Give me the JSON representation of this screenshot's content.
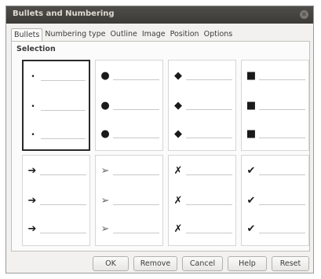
{
  "window": {
    "title": "Bullets and Numbering"
  },
  "tabs": [
    "Bullets",
    "Numbering type",
    "Outline",
    "Image",
    "Position",
    "Options"
  ],
  "section": {
    "title": "Selection"
  },
  "cells": [
    {
      "name": "small-dot",
      "glyph": "•"
    },
    {
      "name": "big-dot",
      "glyph": "●"
    },
    {
      "name": "diamond",
      "glyph": "◆"
    },
    {
      "name": "square",
      "glyph": "■"
    },
    {
      "name": "arrow",
      "glyph": "➔"
    },
    {
      "name": "arrowhead",
      "glyph": "➢"
    },
    {
      "name": "cross",
      "glyph": "✗"
    },
    {
      "name": "check",
      "glyph": "✔"
    }
  ],
  "selected_index": 0,
  "buttons": {
    "ok": "OK",
    "remove": "Remove",
    "cancel": "Cancel",
    "help": "Help",
    "reset": "Reset"
  }
}
